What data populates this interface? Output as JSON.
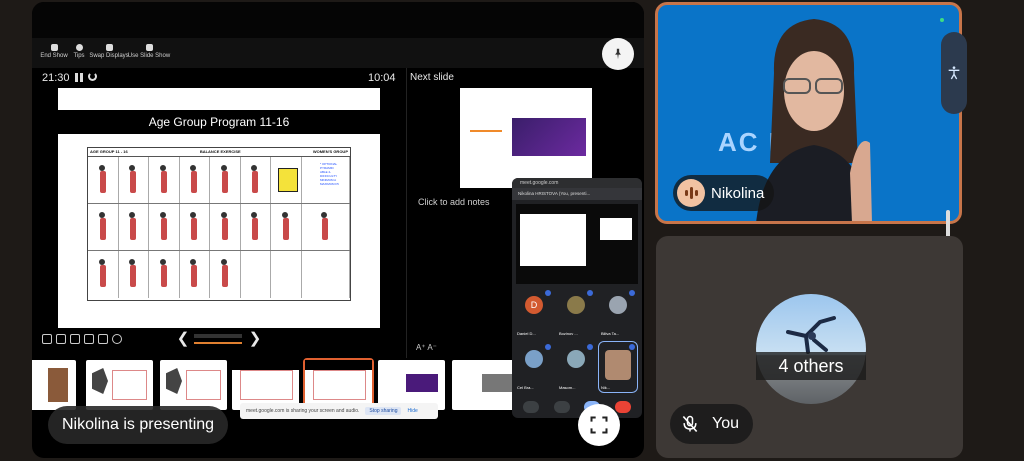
{
  "presenter_view": {
    "toolbar": [
      {
        "label": "End Show",
        "icon": "end-show-icon"
      },
      {
        "label": "Tips",
        "icon": "tips-icon"
      },
      {
        "label": "Swap Displays",
        "icon": "swap-icon"
      },
      {
        "label": "Use Slide Show",
        "icon": "slideshow-icon"
      }
    ],
    "elapsed_timer": "21:30",
    "clock": "10:04",
    "next_slide_label": "Next slide",
    "notes_placeholder": "Click to add notes",
    "font_adjust": "A⁺  A⁻",
    "current_slide": {
      "title": "Age Group Program 11-16",
      "table_header_left": "AGE GROUP 11 - 16",
      "table_header_mid": "BALANCE  EXERCISE",
      "table_header_right": "WOMEN'S GROUP",
      "note_lines": [
        "* OPTIONAL",
        "PYRAMID",
        "ABLE 2-",
        "DIFFICULTY",
        "MINIMUM A",
        "MAXIMUM F5"
      ]
    }
  },
  "share_notice": {
    "text": "meet.google.com is sharing your screen and audio.",
    "stop_label": "Stop sharing",
    "hide_label": "Hide"
  },
  "presenting_label": "Nikolina is presenting",
  "mini_meet": {
    "url": "meet.google.com",
    "subtitle": "Nikolina HRISTOVA (You, presenti...",
    "tiles": [
      {
        "name": "Daniel D...",
        "initial": "D",
        "color": "#d35a30"
      },
      {
        "name": "Bozinov ...",
        "initial": "",
        "color": "#5a6a3a"
      },
      {
        "name": "Biliva Ta...",
        "initial": "",
        "color": "#4a5a6e"
      },
      {
        "name": "Cel Bra...",
        "initial": "",
        "color": "#3c5e8a"
      },
      {
        "name": "Masom...",
        "initial": "",
        "color": "#4a5e6e"
      },
      {
        "name": "Nik...",
        "initial": "",
        "color": "#2a3f78"
      }
    ]
  },
  "participants": {
    "main": {
      "name": "Nikolina",
      "background_text": "AC    ICS",
      "accent": "#c7754a"
    },
    "others": {
      "label": "4 others"
    },
    "self": {
      "label": "You",
      "mic_state": "muted"
    }
  },
  "icons": {
    "pin": "pin-icon",
    "fullscreen": "fullscreen-icon",
    "accessibility": "accessibility-icon",
    "mic_off": "mic-off-icon"
  }
}
